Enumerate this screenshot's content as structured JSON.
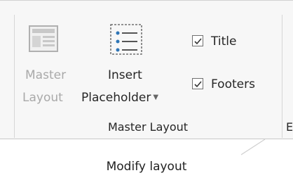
{
  "group": {
    "name": "Master Layout",
    "master_layout_button": {
      "line1": "Master",
      "line2": "Layout"
    },
    "insert_placeholder_button": {
      "line1": "Insert",
      "line2": "Placeholder"
    },
    "title_checkbox": {
      "label": "Title",
      "checked": true
    },
    "footers_checkbox": {
      "label": "Footers",
      "checked": true
    }
  },
  "next_group_initial": "E",
  "caption": "Modify layout"
}
